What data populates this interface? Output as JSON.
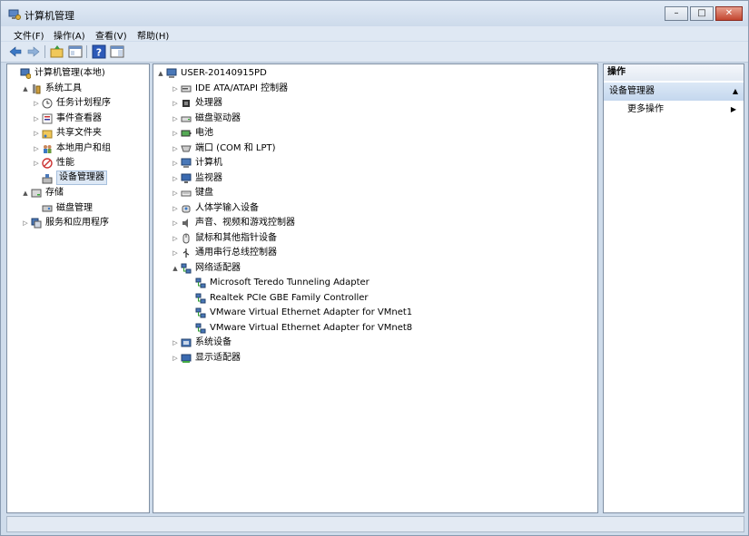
{
  "window": {
    "title": "计算机管理",
    "minimize_glyph": "–",
    "maximize_glyph": "□",
    "close_glyph": "✕"
  },
  "menu": [
    "文件(F)",
    "操作(A)",
    "查看(V)",
    "帮助(H)"
  ],
  "left_tree": [
    {
      "label": "计算机管理(本地)",
      "level": 0,
      "arrow": "",
      "icon": "computer-management-icon"
    },
    {
      "label": "系统工具",
      "level": 1,
      "arrow": "▲",
      "icon": "tools-icon"
    },
    {
      "label": "任务计划程序",
      "level": 2,
      "arrow": "▷",
      "icon": "clock-icon"
    },
    {
      "label": "事件查看器",
      "level": 2,
      "arrow": "▷",
      "icon": "event-viewer-icon"
    },
    {
      "label": "共享文件夹",
      "level": 2,
      "arrow": "▷",
      "icon": "shared-folder-icon"
    },
    {
      "label": "本地用户和组",
      "level": 2,
      "arrow": "▷",
      "icon": "users-icon"
    },
    {
      "label": "性能",
      "level": 2,
      "arrow": "▷",
      "icon": "performance-icon"
    },
    {
      "label": "设备管理器",
      "level": 2,
      "arrow": "",
      "icon": "device-manager-icon",
      "selected": true
    },
    {
      "label": "存储",
      "level": 1,
      "arrow": "▲",
      "icon": "storage-icon"
    },
    {
      "label": "磁盘管理",
      "level": 2,
      "arrow": "",
      "icon": "disk-management-icon"
    },
    {
      "label": "服务和应用程序",
      "level": 1,
      "arrow": "▷",
      "icon": "services-icon"
    }
  ],
  "device_tree": [
    {
      "label": "USER-20140915PD",
      "level": 0,
      "arrow": "▲",
      "icon": "computer-icon"
    },
    {
      "label": "IDE ATA/ATAPI 控制器",
      "level": 1,
      "arrow": "▷",
      "icon": "ide-controller-icon"
    },
    {
      "label": "处理器",
      "level": 1,
      "arrow": "▷",
      "icon": "processor-icon"
    },
    {
      "label": "磁盘驱动器",
      "level": 1,
      "arrow": "▷",
      "icon": "disk-drive-icon"
    },
    {
      "label": "电池",
      "level": 1,
      "arrow": "▷",
      "icon": "battery-icon"
    },
    {
      "label": "端口 (COM 和 LPT)",
      "level": 1,
      "arrow": "▷",
      "icon": "port-icon"
    },
    {
      "label": "计算机",
      "level": 1,
      "arrow": "▷",
      "icon": "computer-icon"
    },
    {
      "label": "监视器",
      "level": 1,
      "arrow": "▷",
      "icon": "monitor-icon"
    },
    {
      "label": "键盘",
      "level": 1,
      "arrow": "▷",
      "icon": "keyboard-icon"
    },
    {
      "label": "人体学输入设备",
      "level": 1,
      "arrow": "▷",
      "icon": "hid-icon"
    },
    {
      "label": "声音、视频和游戏控制器",
      "level": 1,
      "arrow": "▷",
      "icon": "sound-icon"
    },
    {
      "label": "鼠标和其他指针设备",
      "level": 1,
      "arrow": "▷",
      "icon": "mouse-icon"
    },
    {
      "label": "通用串行总线控制器",
      "level": 1,
      "arrow": "▷",
      "icon": "usb-icon"
    },
    {
      "label": "网络适配器",
      "level": 1,
      "arrow": "▲",
      "icon": "network-adapter-icon"
    },
    {
      "label": "Microsoft Teredo Tunneling Adapter",
      "level": 2,
      "arrow": "",
      "icon": "network-adapter-icon"
    },
    {
      "label": "Realtek PCIe GBE Family Controller",
      "level": 2,
      "arrow": "",
      "icon": "network-adapter-icon"
    },
    {
      "label": "VMware Virtual Ethernet Adapter for VMnet1",
      "level": 2,
      "arrow": "",
      "icon": "network-adapter-icon"
    },
    {
      "label": "VMware Virtual Ethernet Adapter for VMnet8",
      "level": 2,
      "arrow": "",
      "icon": "network-adapter-icon"
    },
    {
      "label": "系统设备",
      "level": 1,
      "arrow": "▷",
      "icon": "system-device-icon"
    },
    {
      "label": "显示适配器",
      "level": 1,
      "arrow": "▷",
      "icon": "display-adapter-icon"
    }
  ],
  "actions": {
    "header": "操作",
    "section": "设备管理器",
    "section_arrow": "▲",
    "more": "更多操作",
    "more_arrow": "▶"
  },
  "colors": {
    "title_bar": "#cbd9ea",
    "selection": "#dde8f5",
    "close_button": "#c2452f"
  }
}
